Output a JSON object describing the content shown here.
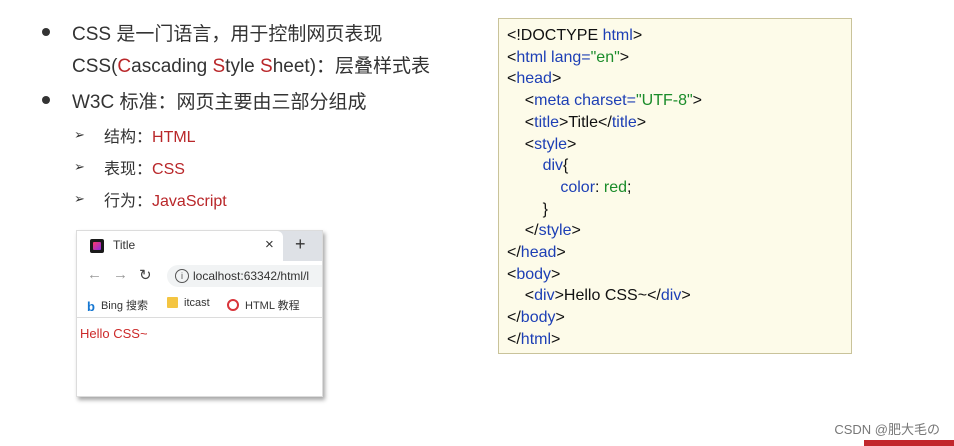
{
  "bullets": {
    "b1_line1_pre": "CSS 是一门语言，用于控制网页表现",
    "b1_line2_prefix": "CSS(",
    "b1_c": "C",
    "b1_ascading": "ascading ",
    "b1_s": "S",
    "b1_tyle": "tyle ",
    "b1_s2": "S",
    "b1_heet": "heet",
    "b1_suffix": ")：层叠样式表",
    "b2": "W3C 标准：网页主要由三部分组成"
  },
  "subitems": [
    {
      "label": "结构：",
      "value": "HTML"
    },
    {
      "label": "表现：",
      "value": "CSS"
    },
    {
      "label": "行为：",
      "value": "JavaScript"
    }
  ],
  "browser": {
    "tab_title": "Title",
    "close": "×",
    "plus": "+",
    "url": "localhost:63342/html/l",
    "bookmarks": [
      "Bing 搜索",
      "itcast",
      "HTML 教程"
    ],
    "page_text": "Hello CSS~",
    "bing_glyph": "b",
    "info_glyph": "i",
    "back_glyph": "←",
    "forward_glyph": "→",
    "reload_glyph": "↻"
  },
  "code": {
    "l1_open": "<!DOCTYPE ",
    "l1_html": "html",
    "l1_close": ">",
    "l2_lt": "<",
    "l2_html": "html",
    "l2_attr": " lang=",
    "l2_str": "\"en\"",
    "l2_gt": ">",
    "l3_lt": "<",
    "l3_tag": "head",
    "l3_gt": ">",
    "l4_lt": "<",
    "l4_tag": "meta",
    "l4_attr": " charset=",
    "l4_str": "\"UTF-8\"",
    "l4_gt": ">",
    "l5_lt": "<",
    "l5_tag": "title",
    "l5_gt": ">",
    "l5_text": "Title",
    "l5_lt2": "</",
    "l5_tag2": "title",
    "l5_gt2": ">",
    "l6_lt": "<",
    "l6_tag": "style",
    "l6_gt": ">",
    "l7_sel": "div",
    "l7_brace": "{",
    "l8_prop": "color",
    "l8_colon": ": ",
    "l8_val": "red",
    "l8_semi": ";",
    "l9": "}",
    "l10_lt": "</",
    "l10_tag": "style",
    "l10_gt": ">",
    "l11_lt": "</",
    "l11_tag": "head",
    "l11_gt": ">",
    "l12_lt": "<",
    "l12_tag": "body",
    "l12_gt": ">",
    "l13_lt": "<",
    "l13_tag": "div",
    "l13_gt": ">",
    "l13_text": "Hello CSS~",
    "l13_lt2": "</",
    "l13_tag2": "div",
    "l13_gt2": ">",
    "l14_lt": "</",
    "l14_tag": "body",
    "l14_gt": ">",
    "l15_lt": "</",
    "l15_tag": "html",
    "l15_gt": ">"
  },
  "watermark": "CSDN @肥大毛の",
  "colors": {
    "accent_red": "#b9272a",
    "code_blue": "#1d3fb5",
    "code_green": "#1a8c2a",
    "code_bg": "#fdfbe9"
  }
}
